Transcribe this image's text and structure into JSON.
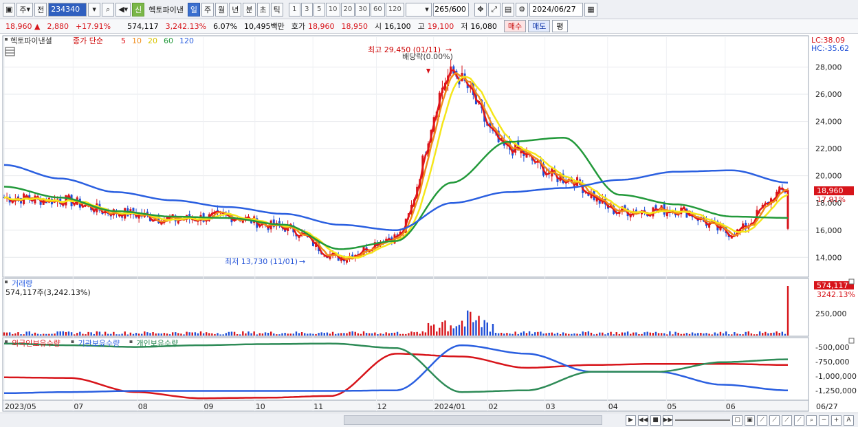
{
  "toolbar": {
    "mode": "주",
    "prev_label": "전",
    "code": "234340",
    "badge_new": "신",
    "stock_name": "헥토파이낸",
    "periods": [
      "일",
      "주",
      "월",
      "년",
      "분",
      "초",
      "틱"
    ],
    "active_period": "일",
    "intervals": [
      "1",
      "3",
      "5",
      "10",
      "20",
      "30",
      "60",
      "120"
    ],
    "count": "265",
    "count_total": "/600",
    "date": "2024/06/27"
  },
  "quote": {
    "price": "18,960",
    "arrow": "▲",
    "change": "2,880",
    "change_pct": "+17.91%",
    "volume": "574,117",
    "volume_pct": "3,242.13%",
    "turnover_pct": "6.07%",
    "amount": "10,495백만",
    "bid_label": "호가",
    "ask_price": "18,960",
    "bid_price": "18,950",
    "open_label": "시",
    "open": "16,100",
    "high_label": "고",
    "high": "19,100",
    "low_label": "저",
    "low": "16,080",
    "buy_label": "매수",
    "sell_label": "매도",
    "avg_label": "평"
  },
  "price_panel": {
    "legend_name": "헥토파이낸셜",
    "legend_type": "종가 단순",
    "ma_labels": [
      "5",
      "10",
      "20",
      "60",
      "120"
    ],
    "ma_colors": [
      "#e0151b",
      "#f08c1a",
      "#f5e61a",
      "#22993a",
      "#2a5fe0"
    ],
    "lc": "LC:38.09",
    "hc": "HC:-35.62",
    "high_note": "최고 29,450 (01/11)",
    "dividend_note": "배당락(0.00%)",
    "low_note": "최저 13,730 (11/01)",
    "last_price_tag": "18,960",
    "last_pct_tag": "17.91%"
  },
  "volume_panel": {
    "title": "거래량",
    "subtitle": "574,117주(3,242.13%)",
    "tag_value": "574,117",
    "tag_pct": "3242.13%",
    "axis_label": "250,000"
  },
  "holdings_panel": {
    "legend": [
      "외국인보유수량",
      "기관보유수량",
      "개인보유수량"
    ],
    "colors": [
      "#d7141a",
      "#2a5fe0",
      "#2e8b57"
    ],
    "axis_labels": [
      "-500,000",
      "-750,000",
      "-1,000,000",
      "-1,250,000"
    ]
  },
  "x_axis": {
    "labels": [
      "2023/05",
      "07",
      "08",
      "09",
      "10",
      "11",
      "12",
      "2024/01",
      "02",
      "03",
      "04",
      "05",
      "06",
      "06/27"
    ]
  },
  "chart_data": {
    "type": "line",
    "title": "헥토파이낸셜",
    "y_axis_labels": [
      "14,000",
      "16,000",
      "18,000",
      "20,000",
      "22,000",
      "24,000",
      "26,000",
      "28,000"
    ],
    "ylim": [
      12700,
      30200
    ],
    "x": [
      "2023/05",
      "06",
      "07",
      "08",
      "09",
      "10",
      "11",
      "12",
      "2024/01",
      "02",
      "03",
      "04",
      "05",
      "06",
      "06/27"
    ],
    "series": [
      {
        "name": "종가",
        "values": [
          18400,
          18200,
          17300,
          16800,
          17000,
          16200,
          14000,
          15500,
          27500,
          22000,
          19800,
          17400,
          17500,
          15800,
          18960
        ]
      },
      {
        "name": "60",
        "values": [
          19200,
          18400,
          17400,
          17000,
          16900,
          16400,
          14600,
          15200,
          19500,
          22500,
          22800,
          18600,
          17900,
          17000,
          16900
        ]
      },
      {
        "name": "120",
        "values": [
          20800,
          19800,
          18800,
          18200,
          17700,
          17200,
          16400,
          16000,
          18000,
          18800,
          19100,
          19700,
          20300,
          20400,
          19500
        ]
      }
    ]
  }
}
